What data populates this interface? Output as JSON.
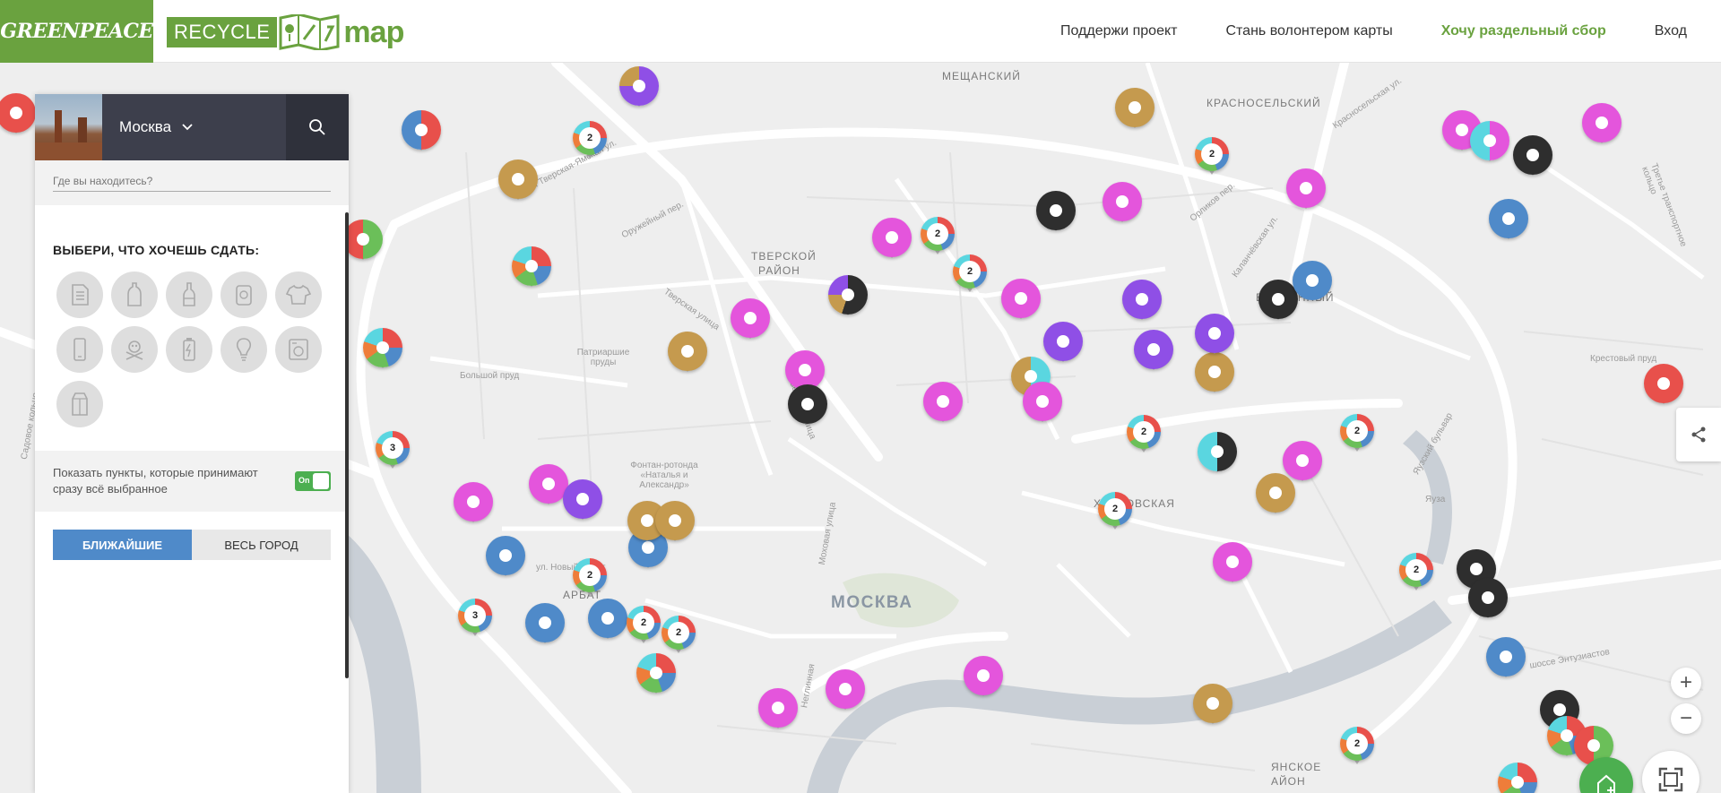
{
  "header": {
    "greenpeace_logo": "GREENPEACE",
    "recycle_logo": "RECYCLE",
    "map_logo": "map",
    "nav": [
      {
        "label": "Поддержи проект"
      },
      {
        "label": "Стань волонтером карты"
      },
      {
        "label": "Хочу раздельный сбор"
      },
      {
        "label": "Вход"
      }
    ]
  },
  "sidebar": {
    "city": "Москва",
    "location_placeholder": "Где вы находитесь?",
    "title": "ВЫБЕРИ, ЧТО ХОЧЕШЬ СДАТЬ:",
    "categories": [
      "paper-icon",
      "plastic-bottle-icon",
      "glass-bottle-icon",
      "metal-can-icon",
      "clothes-icon",
      "phone-icon",
      "hazardous-icon",
      "battery-icon",
      "lightbulb-icon",
      "appliance-icon",
      "tetrapak-icon"
    ],
    "toggle_text": "Показать пункты, которые принимают сразу всё выбранное",
    "toggle_label": "On",
    "tab_nearest": "БЛИЖАЙШИЕ",
    "tab_city": "ВЕСЬ ГОРОД"
  },
  "map": {
    "city_label": "МОСКВА",
    "districts": [
      {
        "text": "МЕЩАНСКИЙ"
      },
      {
        "text": "КРАСНОСЕЛЬСКИЙ"
      },
      {
        "text": "ТВЕРСКОЙ"
      },
      {
        "text": "РАЙОН"
      },
      {
        "text": "БАСМАННЫЙ"
      },
      {
        "text": "АРБАТ"
      },
      {
        "text": "ХИТРОВСКАЯ"
      },
      {
        "text": "ЯНСКОЕ"
      },
      {
        "text": "АЙОН"
      }
    ],
    "streets": [
      {
        "text": "1-я Тверская-Ямская ул."
      },
      {
        "text": "Оружейный пер."
      },
      {
        "text": "Тверская улица"
      },
      {
        "text": "Тверская улица"
      },
      {
        "text": "Патриаршие пруды"
      },
      {
        "text": "Большой пруд"
      },
      {
        "text": "Фонтан-ротонда «Наталья и Александр»"
      },
      {
        "text": "ул. Новый Арбат"
      },
      {
        "text": "Моховая улица"
      },
      {
        "text": "Неглинная"
      },
      {
        "text": "Орликов пер."
      },
      {
        "text": "Каланчёвская ул."
      },
      {
        "text": "Красносельская ул."
      },
      {
        "text": "Третье транспортное кольцо"
      },
      {
        "text": "Крестовый пруд"
      },
      {
        "text": "Яузский бульвар"
      },
      {
        "text": "Яуза"
      },
      {
        "text": "шоссе Энтузиастов"
      },
      {
        "text": "Садовое кольцо"
      }
    ],
    "colors": {
      "pink": "#e455dc",
      "gold": "#c59a4e",
      "black": "#2e2e2e",
      "purple": "#8f4fe6",
      "blue": "#4f8ac9",
      "red": "#e8504b",
      "green": "#6bbf59",
      "cyan": "#5ad6e0",
      "orange": "#ee7d3a"
    }
  }
}
